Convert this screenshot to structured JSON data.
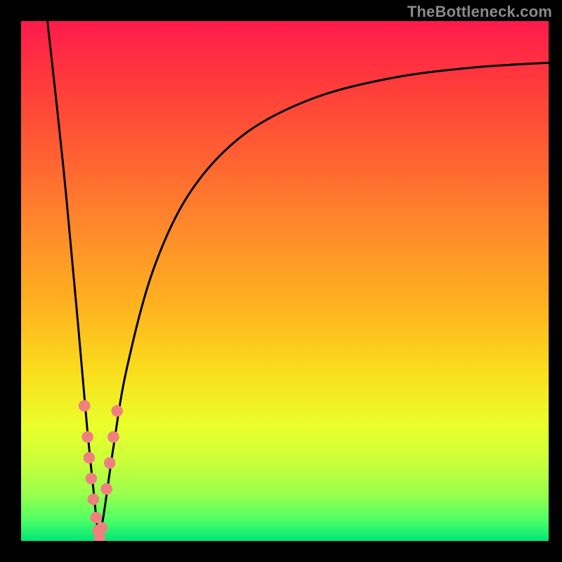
{
  "watermark": {
    "text": "TheBottleneck.com"
  },
  "chart_data": {
    "type": "line",
    "title": "",
    "xlabel": "",
    "ylabel": "",
    "xlim": [
      0,
      100
    ],
    "ylim": [
      0,
      100
    ],
    "axes_visible": false,
    "grid": false,
    "background_gradient": {
      "orientation": "vertical",
      "stops": [
        {
          "pos": 0.0,
          "hex": "#ff1a4d"
        },
        {
          "pos": 0.5,
          "hex": "#ffb31f"
        },
        {
          "pos": 0.78,
          "hex": "#eaff2b"
        },
        {
          "pos": 1.0,
          "hex": "#00e676"
        }
      ]
    },
    "series": [
      {
        "name": "left-branch",
        "x": [
          5.0,
          8.0,
          10.5,
          12.5,
          13.7,
          14.3,
          14.8
        ],
        "y": [
          100,
          72,
          45,
          22,
          10,
          4,
          0
        ]
      },
      {
        "name": "right-branch",
        "x": [
          14.8,
          15.8,
          17.5,
          20.0,
          25.0,
          32.0,
          42.0,
          55.0,
          70.0,
          85.0,
          100.0
        ],
        "y": [
          0,
          6,
          18,
          33,
          52,
          67,
          78,
          85,
          89,
          91,
          92
        ]
      }
    ],
    "markers": {
      "name": "salmon-dots",
      "color": "#f08080",
      "radius_fraction": 0.011,
      "points": [
        {
          "x": 12.0,
          "y": 26
        },
        {
          "x": 12.6,
          "y": 20
        },
        {
          "x": 12.9,
          "y": 16
        },
        {
          "x": 13.3,
          "y": 12
        },
        {
          "x": 13.7,
          "y": 8
        },
        {
          "x": 14.2,
          "y": 4.5
        },
        {
          "x": 14.6,
          "y": 2
        },
        {
          "x": 14.9,
          "y": 0.5
        },
        {
          "x": 15.3,
          "y": 2.5
        },
        {
          "x": 16.2,
          "y": 10
        },
        {
          "x": 16.8,
          "y": 15
        },
        {
          "x": 17.5,
          "y": 20
        },
        {
          "x": 18.2,
          "y": 25
        }
      ]
    }
  }
}
